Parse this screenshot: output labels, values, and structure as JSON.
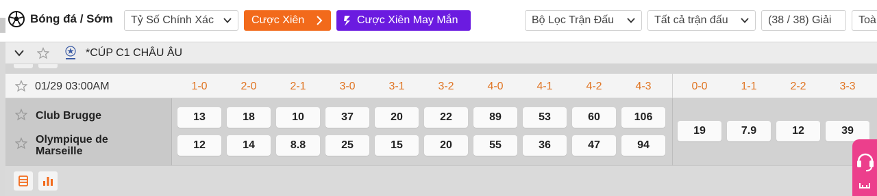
{
  "toolbar": {
    "sport_label": "Bóng đá / Sớm",
    "bet_type": "Tỷ Số Chính Xác",
    "parlay_label": "Cược Xiên",
    "lucky_parlay_label": "Cược Xiên May Mắn",
    "match_filter": "Bộ Lọc Trận Đấu",
    "all_matches": "Tất cả trận đấu",
    "league_count": "(38 / 38) Giải",
    "cut_label": "Toà"
  },
  "league": {
    "name": "*CÚP C1 CHÂU ÂU"
  },
  "header": {
    "datetime": "01/29 03:00AM",
    "scores": [
      "1-0",
      "2-0",
      "2-1",
      "3-0",
      "3-1",
      "3-2",
      "4-0",
      "4-1",
      "4-2",
      "4-3",
      "0-0",
      "1-1",
      "2-2",
      "3-3"
    ]
  },
  "match": {
    "home": "Club Brugge",
    "away_line1": "Olympique de",
    "away_line2": "Marseille",
    "home_odds": [
      "13",
      "18",
      "10",
      "37",
      "20",
      "22",
      "89",
      "53",
      "60",
      "106"
    ],
    "away_odds": [
      "12",
      "14",
      "8.8",
      "25",
      "15",
      "20",
      "55",
      "36",
      "47",
      "94"
    ],
    "draw_odds": [
      "19",
      "7.9",
      "12",
      "39"
    ]
  },
  "colors": {
    "accent_orange": "#f26a1b",
    "purple": "#6b1be0",
    "support_pink": "#ec3f8c",
    "score_orange": "#e07422"
  },
  "icons": [
    "soccer-ball-icon",
    "chevron-down-icon",
    "chevron-right-icon",
    "lightning-icon",
    "star-icon",
    "champions-league-logo",
    "stats-list-icon",
    "bar-chart-icon",
    "headset-icon"
  ]
}
